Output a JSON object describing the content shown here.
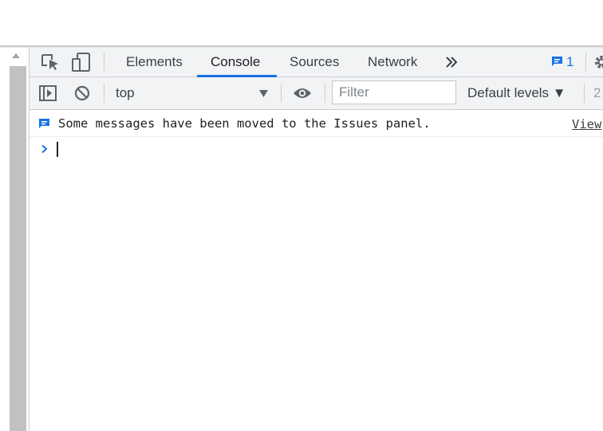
{
  "tabs": {
    "items": [
      {
        "label": "Elements"
      },
      {
        "label": "Console"
      },
      {
        "label": "Sources"
      },
      {
        "label": "Network"
      }
    ],
    "active": "Console",
    "issues_count": "1"
  },
  "toolbar": {
    "context": "top",
    "filter_placeholder": "Filter",
    "levels_label": "Default levels ▼",
    "hidden_count": "2"
  },
  "console": {
    "message": "Some messages have been moved to the Issues panel.",
    "view_link": "View"
  },
  "colors": {
    "accent": "#1a73e8",
    "toolbar_bg": "#f1f3f4",
    "scrollbar": "#c1c1c1"
  }
}
